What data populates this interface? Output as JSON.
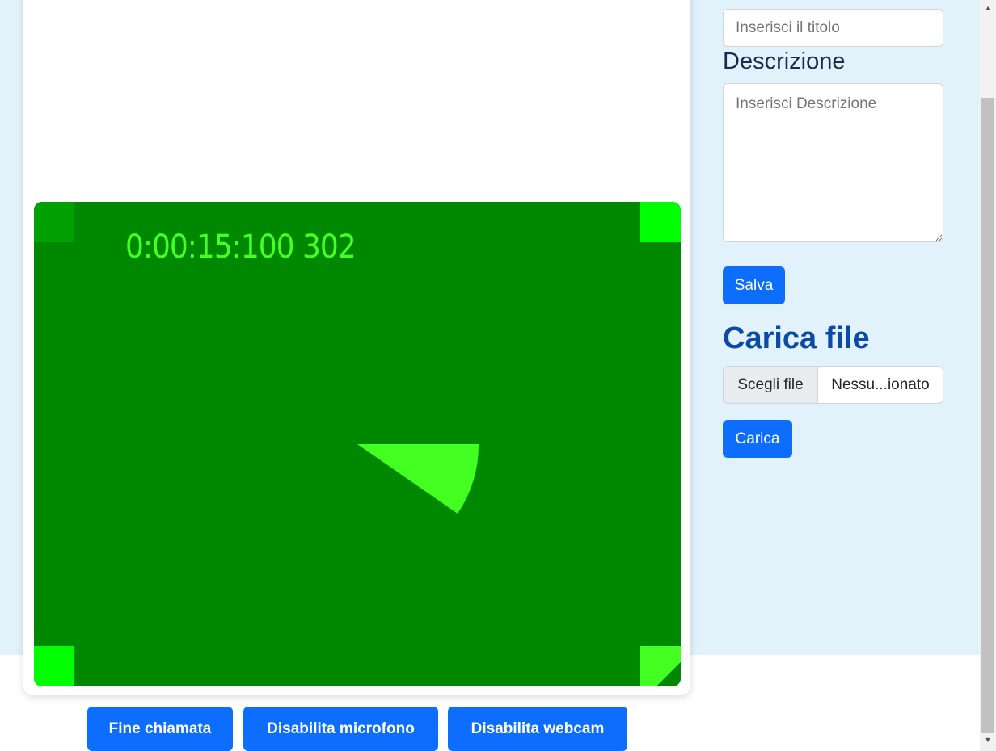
{
  "form": {
    "title_placeholder": "Inserisci il titolo",
    "description_label": "Descrizione",
    "description_placeholder": "Inserisci Descrizione",
    "save_label": "Salva"
  },
  "upload": {
    "heading": "Carica file",
    "choose_label": "Scegli file",
    "file_name": "Nessu...ionato",
    "upload_label": "Carica"
  },
  "video": {
    "timestamp": "0:00:15:100 302"
  },
  "call_controls": {
    "end_call": "Fine chiamata",
    "disable_mic": "Disabilita microfono",
    "disable_webcam": "Disabilita webcam"
  },
  "colors": {
    "primary": "#0d6efd",
    "video_bg": "#008800",
    "video_accent": "#44ff22",
    "page_bg": "#e2f2fa"
  }
}
